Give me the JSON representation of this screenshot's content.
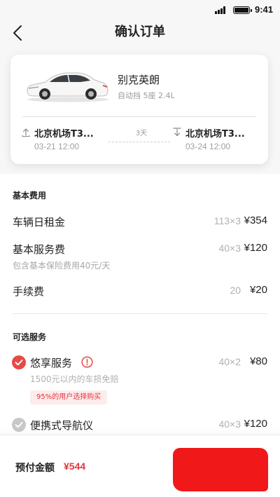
{
  "status_bar": {
    "time": "9:41",
    "signal_icon": "signal-bars-icon",
    "battery_icon": "battery-icon"
  },
  "header": {
    "back_icon": "chevron-left-icon",
    "title": "确认订单"
  },
  "car": {
    "image": "white-sedan-image",
    "name": "别克英朗",
    "spec": "自动挡 5座 2.4L",
    "pickup": {
      "icon": "pickup-arrow-up-icon",
      "location": "北京机场T3...",
      "time": "03-21 12:00"
    },
    "dropoff": {
      "icon": "dropoff-arrow-down-icon",
      "location": "北京机场T3...",
      "time": "03-24 12:00"
    },
    "duration": "3天"
  },
  "basic_fees": {
    "heading": "基本费用",
    "items": [
      {
        "label": "车辆日租金",
        "qty": "113×3",
        "amount": "¥354"
      },
      {
        "label": "基本服务费",
        "qty": "40×3",
        "amount": "¥120",
        "note": "包含基本保险费用40元/天"
      },
      {
        "label": "手续费",
        "qty": "20",
        "amount": "¥20"
      }
    ]
  },
  "optional_services": {
    "heading": "可选服务",
    "items": [
      {
        "label": "悠享服务",
        "qty": "40×2",
        "amount": "¥80",
        "note": "1500元以内的车损免赔",
        "tag": "95%的用户选择购买",
        "checked": true,
        "info_icon": "info-circle-icon"
      },
      {
        "label": "便携式导航仪",
        "qty": "40×3",
        "amount": "¥120",
        "checked": true
      }
    ]
  },
  "footer": {
    "prepay_label": "预付金额",
    "prepay_amount": "¥544"
  },
  "colors": {
    "accent": "#e0383e",
    "pay_button": "#f01818",
    "check_active": "#e64a46",
    "check_inactive": "#c8c8c8",
    "promo_bg": "#fdecec"
  }
}
